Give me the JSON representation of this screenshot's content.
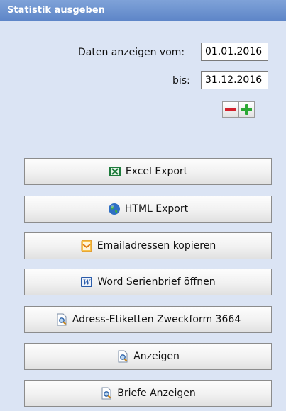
{
  "panel": {
    "title": "Statistik ausgeben",
    "from_label": "Daten anzeigen vom:",
    "from_value": "01.01.2016",
    "to_label": "bis:",
    "to_value": "31.12.2016"
  },
  "buttons": {
    "excel_export": "Excel Export",
    "html_export": "HTML Export",
    "copy_emails": "Emailadressen kopieren",
    "word_serial_letter": "Word Serienbrief öffnen",
    "address_labels": "Adress-Etiketten Zweckform 3664",
    "show": "Anzeigen",
    "show_letters": "Briefe Anzeigen"
  },
  "icons": {
    "excel": "excel-icon",
    "globe": "globe-icon",
    "email": "email-icon",
    "word": "word-icon",
    "preview": "preview-icon"
  },
  "colors": {
    "header_bg": "#6a8fce",
    "panel_bg": "#dbe4f4",
    "minus": "#d3212c",
    "plus": "#2ba834"
  }
}
